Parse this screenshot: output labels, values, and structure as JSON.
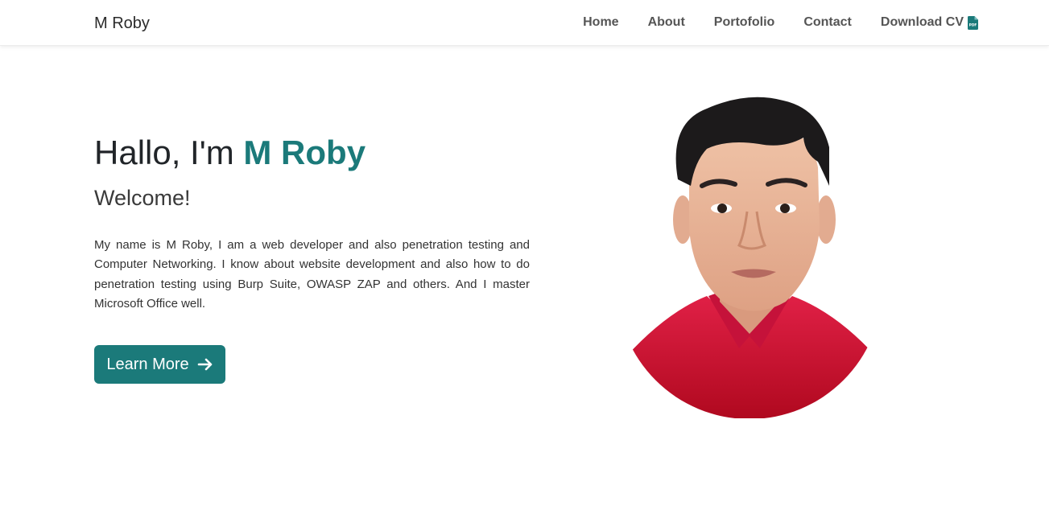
{
  "navbar": {
    "brand": "M Roby",
    "links": [
      {
        "label": "Home"
      },
      {
        "label": "About"
      },
      {
        "label": "Portofolio"
      },
      {
        "label": "Contact"
      },
      {
        "label": "Download CV",
        "icon": "pdf-file-icon"
      }
    ]
  },
  "hero": {
    "greeting": "Hallo, I'm",
    "name": "M Roby",
    "subtitle": "Welcome!",
    "description": "My name is M Roby, I am a web developer and also penetration testing and Computer Networking. I know about website development and also how to do penetration testing using Burp Suite, OWASP ZAP and others. And I master Microsoft Office well.",
    "button_label": "Learn More",
    "button_icon": "arrow-right-icon",
    "portrait_icon": "profile-photo"
  },
  "colors": {
    "accent": "#1b7a7a",
    "button_bg": "#1b7a7a",
    "shirt": "#d01d3e"
  }
}
